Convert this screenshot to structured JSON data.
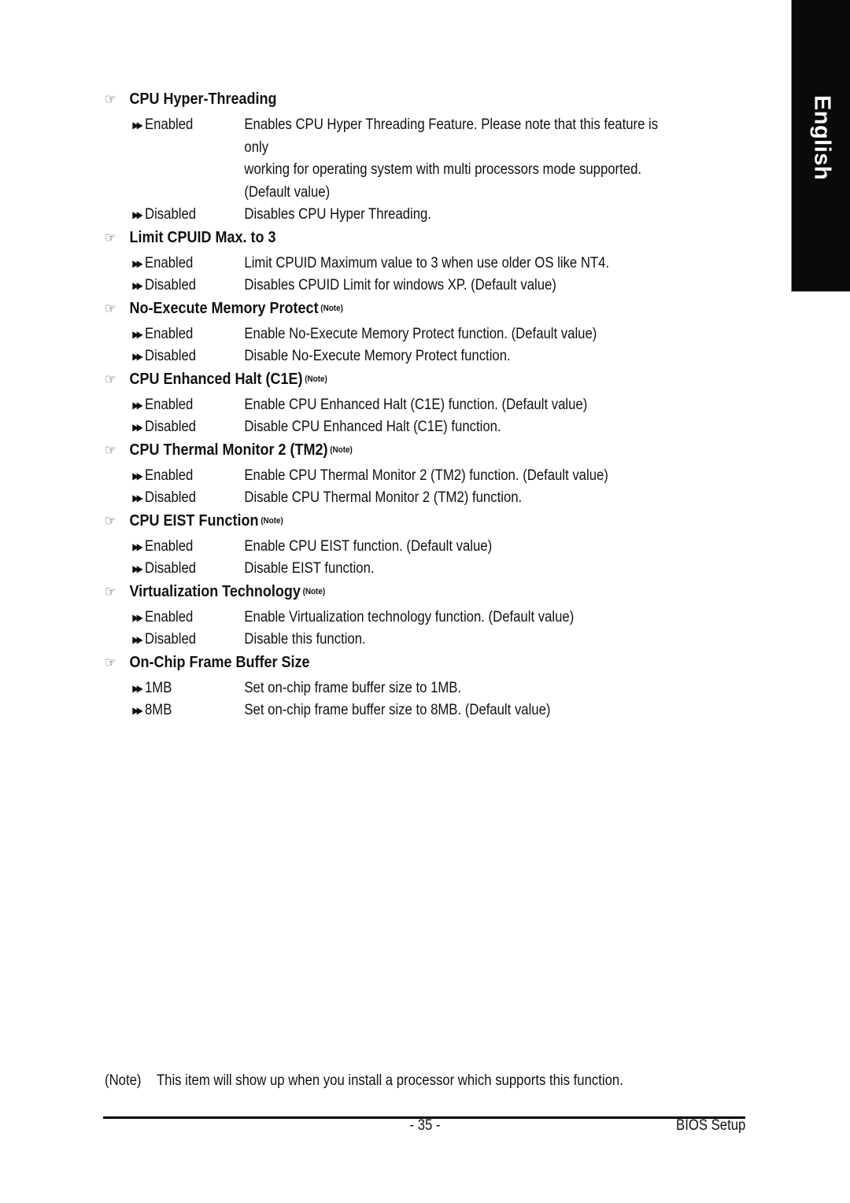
{
  "language_tab": "English",
  "sections": [
    {
      "title": "CPU Hyper-Threading",
      "note": "",
      "options": [
        {
          "label": "Enabled",
          "desc": [
            "Enables CPU Hyper Threading Feature. Please note that this feature is only",
            "working for operating system with multi processors mode supported.",
            "(Default value)"
          ]
        },
        {
          "label": "Disabled",
          "desc": [
            "Disables CPU Hyper Threading."
          ]
        }
      ]
    },
    {
      "title": "Limit CPUID Max. to 3",
      "note": "",
      "options": [
        {
          "label": "Enabled",
          "desc": [
            "Limit CPUID Maximum value to 3 when use older OS like NT4."
          ]
        },
        {
          "label": "Disabled",
          "desc": [
            "Disables CPUID Limit for windows XP. (Default value)"
          ]
        }
      ]
    },
    {
      "title": "No-Execute Memory Protect",
      "note": "(Note)",
      "options": [
        {
          "label": "Enabled",
          "desc": [
            "Enable No-Execute Memory Protect function. (Default value)"
          ]
        },
        {
          "label": "Disabled",
          "desc": [
            "Disable No-Execute Memory Protect function."
          ]
        }
      ]
    },
    {
      "title": "CPU Enhanced Halt (C1E)",
      "note": "(Note)",
      "options": [
        {
          "label": "Enabled",
          "desc": [
            "Enable CPU Enhanced Halt (C1E) function. (Default value)"
          ]
        },
        {
          "label": "Disabled",
          "desc": [
            "Disable CPU Enhanced Halt (C1E) function."
          ]
        }
      ]
    },
    {
      "title": "CPU Thermal Monitor 2 (TM2)",
      "note": "(Note)",
      "options": [
        {
          "label": "Enabled",
          "desc": [
            "Enable CPU Thermal Monitor 2 (TM2) function. (Default value)"
          ]
        },
        {
          "label": "Disabled",
          "desc": [
            "Disable CPU Thermal Monitor 2 (TM2) function."
          ]
        }
      ]
    },
    {
      "title": "CPU EIST Function",
      "note": "(Note)",
      "options": [
        {
          "label": "Enabled",
          "desc": [
            "Enable CPU EIST function. (Default value)"
          ]
        },
        {
          "label": "Disabled",
          "desc": [
            "Disable EIST function."
          ]
        }
      ]
    },
    {
      "title": "Virtualization Technology",
      "note": "(Note)",
      "options": [
        {
          "label": "Enabled",
          "desc": [
            "Enable Virtualization technology function. (Default value)"
          ]
        },
        {
          "label": "Disabled",
          "desc": [
            "Disable this function."
          ]
        }
      ]
    },
    {
      "title": "On-Chip Frame Buffer Size",
      "note": "",
      "options": [
        {
          "label": "1MB",
          "desc": [
            "Set on-chip frame buffer size to 1MB."
          ]
        },
        {
          "label": "8MB",
          "desc": [
            "Set on-chip frame buffer size to 8MB. (Default value)"
          ]
        }
      ]
    }
  ],
  "icons": {
    "section_bullet": "pointing-hand-icon",
    "option_bullet": "double-arrow-icon"
  },
  "footnote": {
    "tag": "(Note)",
    "text": "This item will show up when you install a processor which supports this function."
  },
  "footer": {
    "page_number": "- 35 -",
    "title": "BIOS Setup"
  }
}
